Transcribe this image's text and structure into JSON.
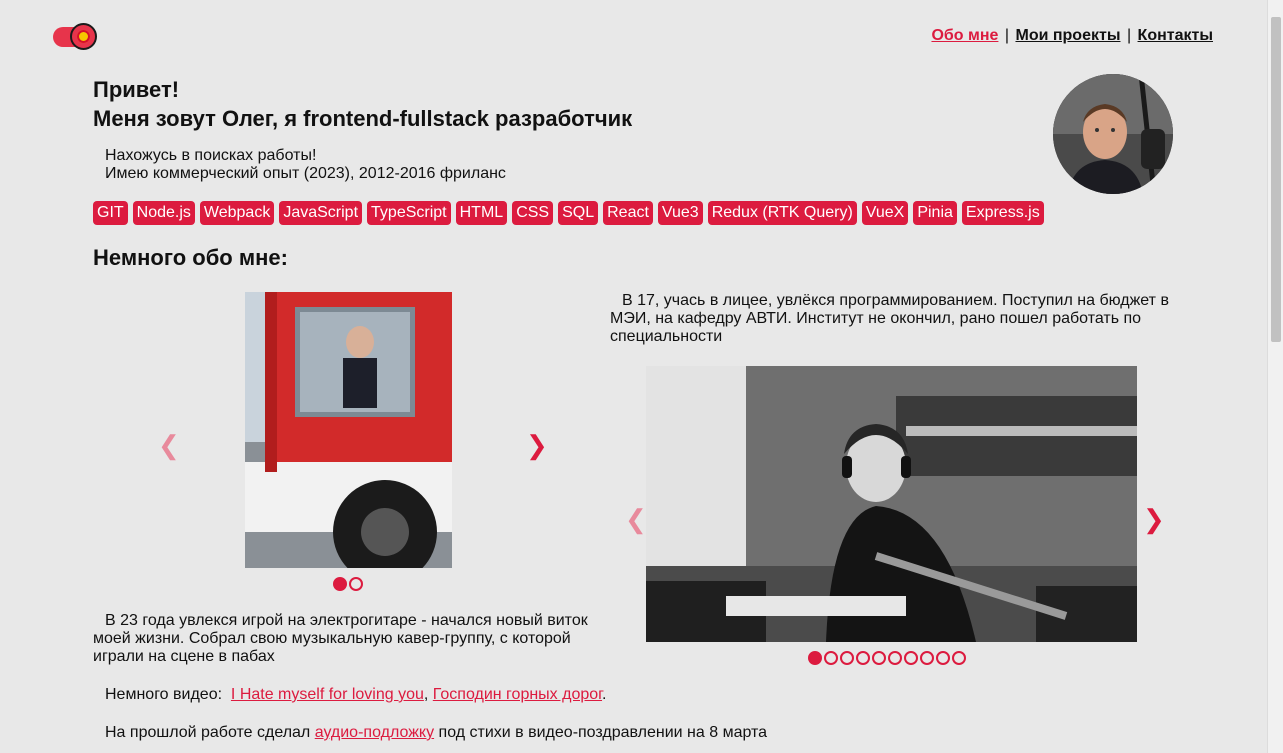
{
  "nav": {
    "items": [
      {
        "label": "Обо мне",
        "active": true
      },
      {
        "label": "Мои проекты",
        "active": false
      },
      {
        "label": "Контакты",
        "active": false
      }
    ],
    "separator": "|"
  },
  "hero": {
    "greeting": "Привет!",
    "intro": "Меня зовут Олег, я frontend-fullstack разработчик",
    "line1": "Нахожусь в поисках работы!",
    "line2": "Имею коммерческий опыт (2023), 2012-2016 фриланс"
  },
  "skills": [
    "GIT",
    "Node.js",
    "Webpack",
    "JavaScript",
    "TypeScript",
    "HTML",
    "CSS",
    "SQL",
    "React",
    "Vue3",
    "Redux (RTK Query)",
    "VueX",
    "Pinia",
    "Express.js"
  ],
  "about": {
    "heading": "Немного обо мне:",
    "text_right": "В 17, учась в лицее, увлёкся программированием. Поступил на бюджет в МЭИ, на кафедру АВТИ. Институт не окончил, рано пошел работать по специальности",
    "text_left": "В 23 года увлекся игрой на электрогитаре - начался новый виток моей жизни. Собрал свою музыкальную кавер-группу, с которой играли на сцене в пабах",
    "video_label": "Немного видео:",
    "video1": "I Hate myself for loving you",
    "video_sep": ",",
    "video2": "Господин горных дорог",
    "video_end": ".",
    "work_before": "На прошлой работе сделал",
    "work_link": "аудио-подложку",
    "work_after": "под стихи в видео-поздравлении на 8 марта"
  },
  "slider_left": {
    "prev": "❮",
    "next": "❯",
    "active_index": 0,
    "count": 2
  },
  "slider_right": {
    "prev": "❮",
    "next": "❯",
    "active_index": 0,
    "count": 10
  },
  "colors": {
    "accent": "#dc1b3f",
    "background": "#e8e8e8"
  }
}
